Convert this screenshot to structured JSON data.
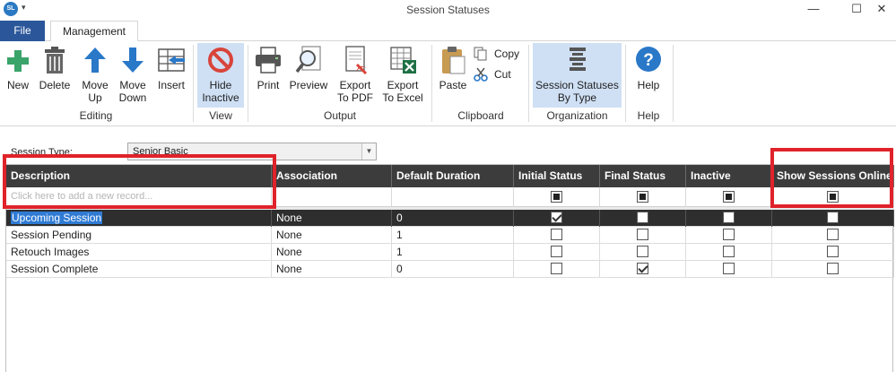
{
  "window": {
    "title": "Session Statuses",
    "app_icon_text": "SL",
    "minimize_glyph": "—",
    "maximize_glyph": "☐",
    "close_glyph": "✕"
  },
  "tabs": {
    "file": "File",
    "management": "Management"
  },
  "ribbon": {
    "buttons": {
      "new": "New",
      "delete": "Delete",
      "move_up_1": "Move",
      "move_up_2": "Up",
      "move_down_1": "Move",
      "move_down_2": "Down",
      "insert": "Insert",
      "hide_inactive_1": "Hide",
      "hide_inactive_2": "Inactive",
      "print": "Print",
      "preview": "Preview",
      "export_pdf_1": "Export",
      "export_pdf_2": "To PDF",
      "export_excel_1": "Export",
      "export_excel_2": "To Excel",
      "paste": "Paste",
      "copy": "Copy",
      "cut": "Cut",
      "session_statuses_by_type_1": "Session Statuses",
      "session_statuses_by_type_2": "By Type",
      "help": "Help"
    },
    "groups": {
      "editing": "Editing",
      "view": "View",
      "output": "Output",
      "clipboard": "Clipboard",
      "organization": "Organization",
      "help": "Help"
    }
  },
  "form": {
    "session_type_label": "Session Type:",
    "session_type_value": "Senior Basic"
  },
  "grid": {
    "columns": [
      "Description",
      "Association",
      "Default Duration",
      "Initial Status",
      "Final Status",
      "Inactive",
      "Show Sessions Online"
    ],
    "new_record_placeholder": "Click here to add a new record...",
    "rows": [
      {
        "description": "Upcoming Session",
        "association": "None",
        "default_duration": "0",
        "initial_status": true,
        "final_status": false,
        "inactive": false,
        "show_online": false,
        "selected": true
      },
      {
        "description": "Session Pending",
        "association": "None",
        "default_duration": "1",
        "initial_status": false,
        "final_status": false,
        "inactive": false,
        "show_online": false,
        "selected": false
      },
      {
        "description": "Retouch Images",
        "association": "None",
        "default_duration": "1",
        "initial_status": false,
        "final_status": false,
        "inactive": false,
        "show_online": false,
        "selected": false
      },
      {
        "description": "Session Complete",
        "association": "None",
        "default_duration": "0",
        "initial_status": false,
        "final_status": true,
        "inactive": false,
        "show_online": false,
        "selected": false
      }
    ]
  },
  "colors": {
    "file_tab": "#2b579a",
    "header_bg": "#3c3c3c",
    "selected_row": "#2e2e2e",
    "selection_highlight": "#2f7bd4",
    "annotation_red": "#e0222a",
    "active_ribbon": "#cfe0f5"
  }
}
